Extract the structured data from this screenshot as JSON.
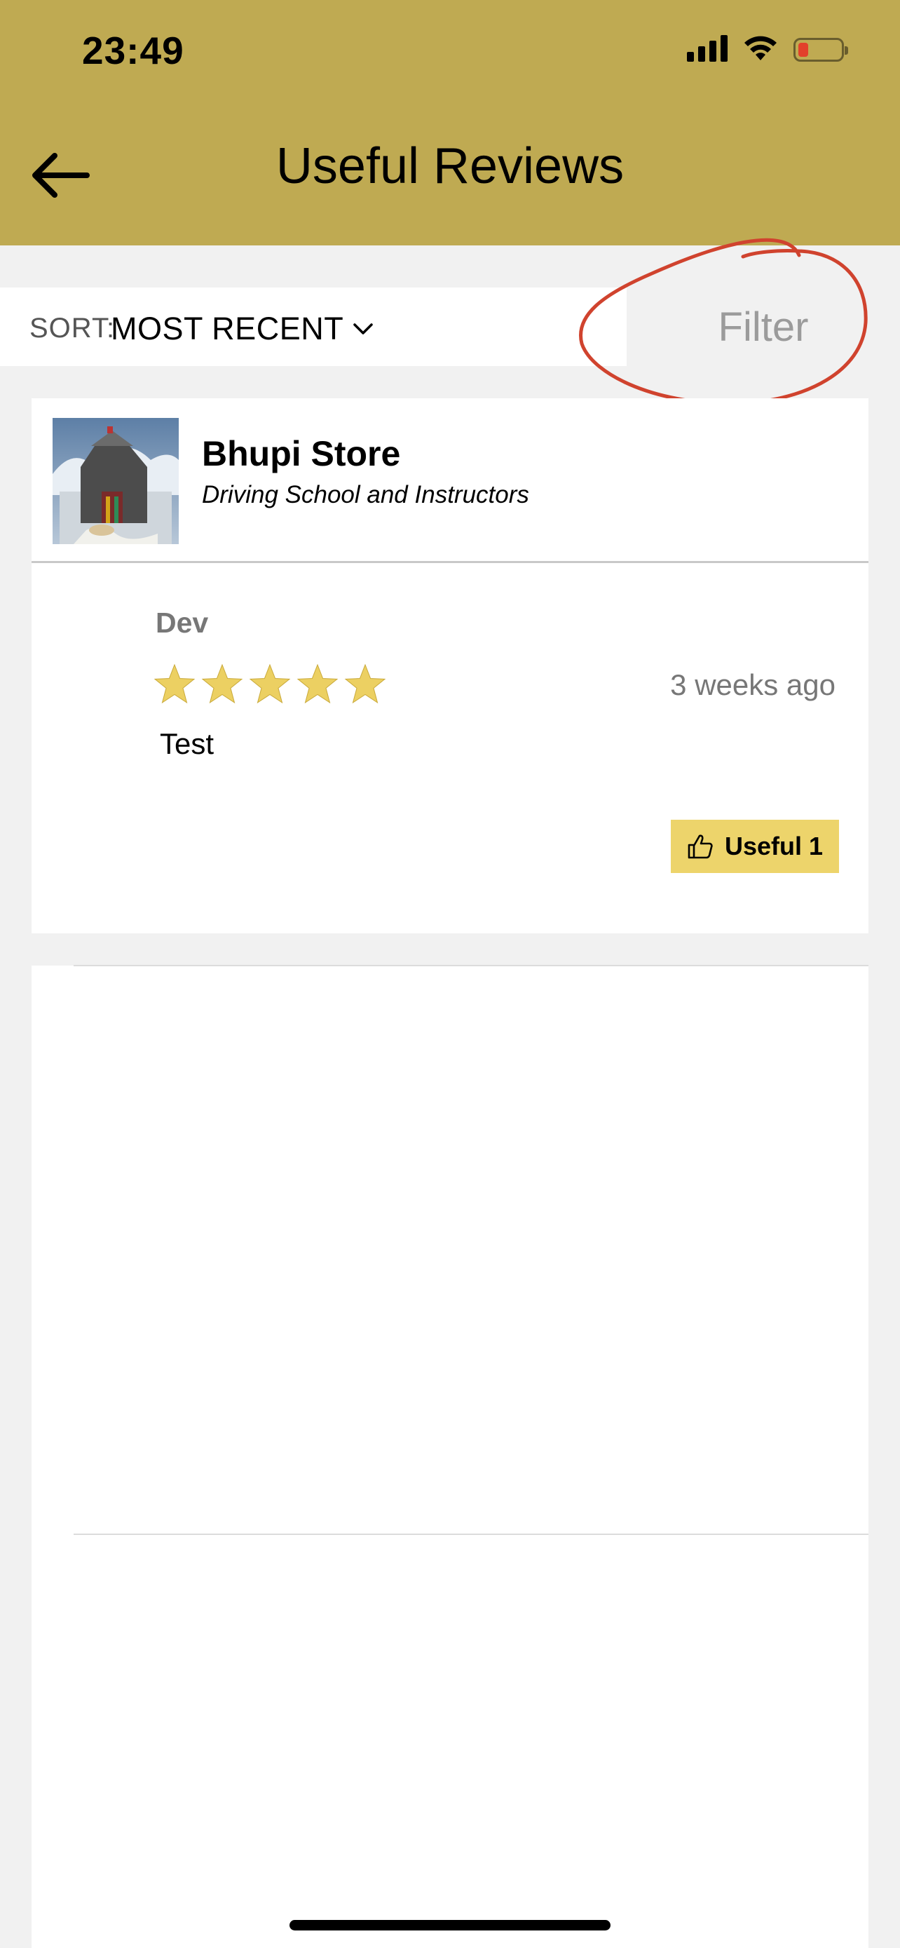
{
  "status_bar": {
    "time": "23:49",
    "icons": [
      "signal-icon",
      "wifi-icon",
      "battery-icon"
    ],
    "battery_color": "#e2402b"
  },
  "header": {
    "title": "Useful Reviews",
    "back_icon": "arrow-left-icon",
    "bg_color": "#bfaa52"
  },
  "sort": {
    "label": "SORT:",
    "value": "MOST RECENT",
    "chevron_icon": "chevron-down-icon"
  },
  "filter": {
    "label": "Filter",
    "annotation_color": "#d0432e"
  },
  "business": {
    "name": "Bhupi Store",
    "category": "Driving School and Instructors"
  },
  "review": {
    "author": "Dev",
    "rating": 5,
    "time": "3 weeks ago",
    "text": "Test",
    "useful": {
      "label": "Useful 1",
      "icon": "thumbs-up-icon"
    },
    "star_color": "#ecd062"
  }
}
